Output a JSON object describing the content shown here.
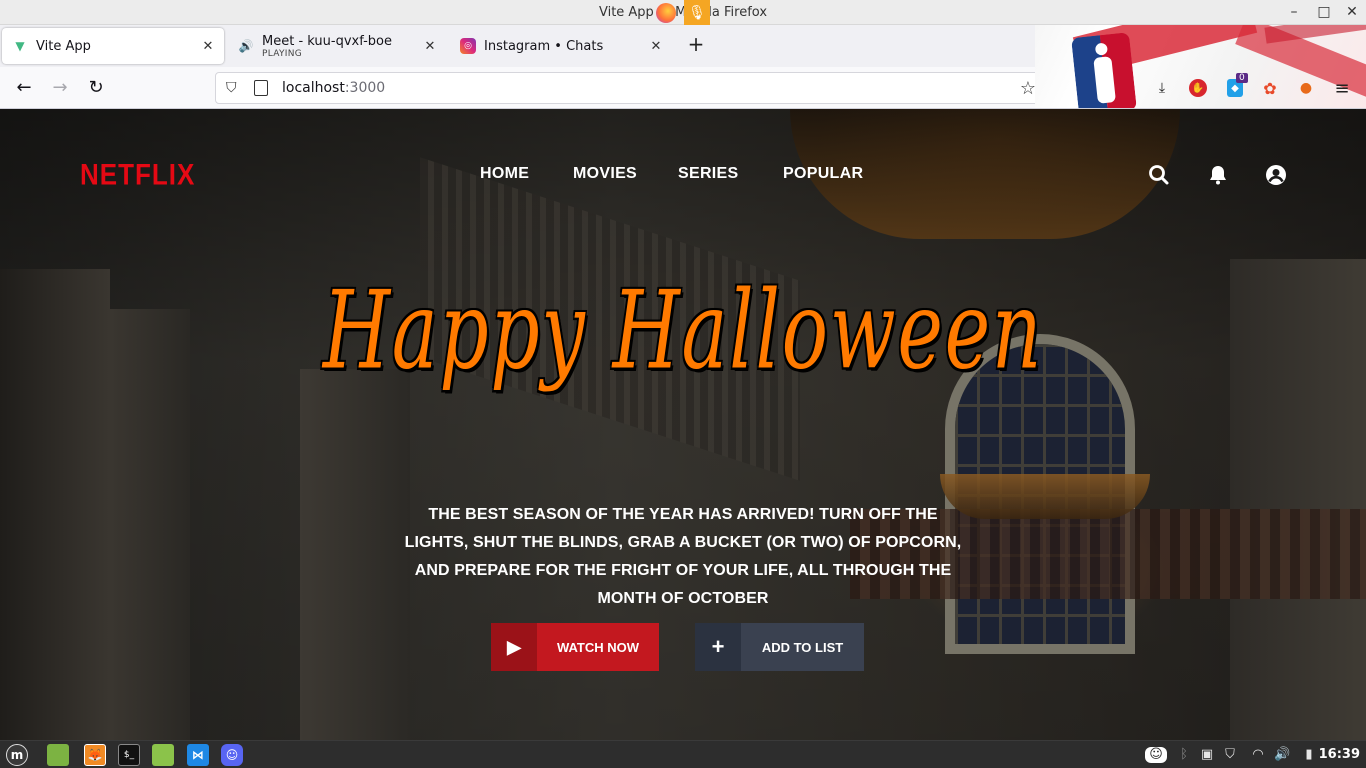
{
  "window": {
    "title": "Vite App — Mozilla Firefox"
  },
  "tabs": [
    {
      "title": "Vite App",
      "subtitle": ""
    },
    {
      "title": "Meet - kuu-qvxf-boe",
      "subtitle": "PLAYING"
    },
    {
      "title": "Instagram • Chats",
      "subtitle": ""
    }
  ],
  "urlbar": {
    "host": "localhost",
    "port": ":3000"
  },
  "extensions": {
    "badge_count": "0"
  },
  "site": {
    "brand": "NETFLIX",
    "nav": [
      "HOME",
      "MOVIES",
      "SERIES",
      "POPULAR"
    ],
    "hero_title": "Happy Halloween",
    "tagline": "The best season of the year has arrived! Turn off the lights, shut the blinds, grab a bucket (or two) of popcorn, and prepare for the fright of your life, all through the month of October",
    "watch_label": "WATCH NOW",
    "add_label": "ADD TO LIST",
    "colors": {
      "brand": "#e50914",
      "title": "#ff7a00",
      "watch": "#c3181f",
      "list": "#3a4150"
    }
  },
  "taskbar": {
    "clock": "16:39"
  }
}
